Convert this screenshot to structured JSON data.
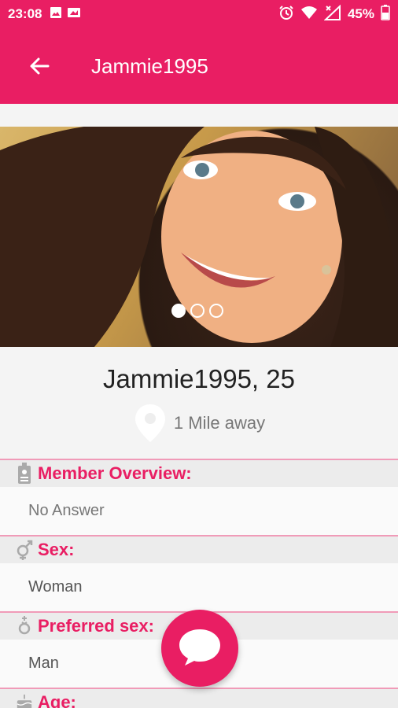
{
  "status_bar": {
    "time": "23:08",
    "battery": "45%",
    "icons": [
      "image-icon",
      "photo-icon",
      "alarm-icon",
      "wifi-icon",
      "no-signal-icon",
      "battery-icon"
    ]
  },
  "app_bar": {
    "title": "Jammie1995",
    "back_icon": "arrow-back-icon",
    "color": "#e91e63"
  },
  "profile": {
    "name_age": "Jammie1995, 25",
    "distance": "1 Mile away",
    "photo_count": 3,
    "active_photo": 0
  },
  "sections": [
    {
      "label": "Member Overview:",
      "value": "No Answer",
      "icon": "id-badge-icon"
    },
    {
      "label": "Sex:",
      "value": "Woman",
      "icon": "gender-icon"
    },
    {
      "label": "Preferred sex:",
      "value": "Man",
      "icon": "preferred-sex-icon"
    },
    {
      "label": "Age:",
      "value": "",
      "icon": "cake-icon"
    }
  ],
  "fab": {
    "icon": "chat-bubble-icon"
  }
}
